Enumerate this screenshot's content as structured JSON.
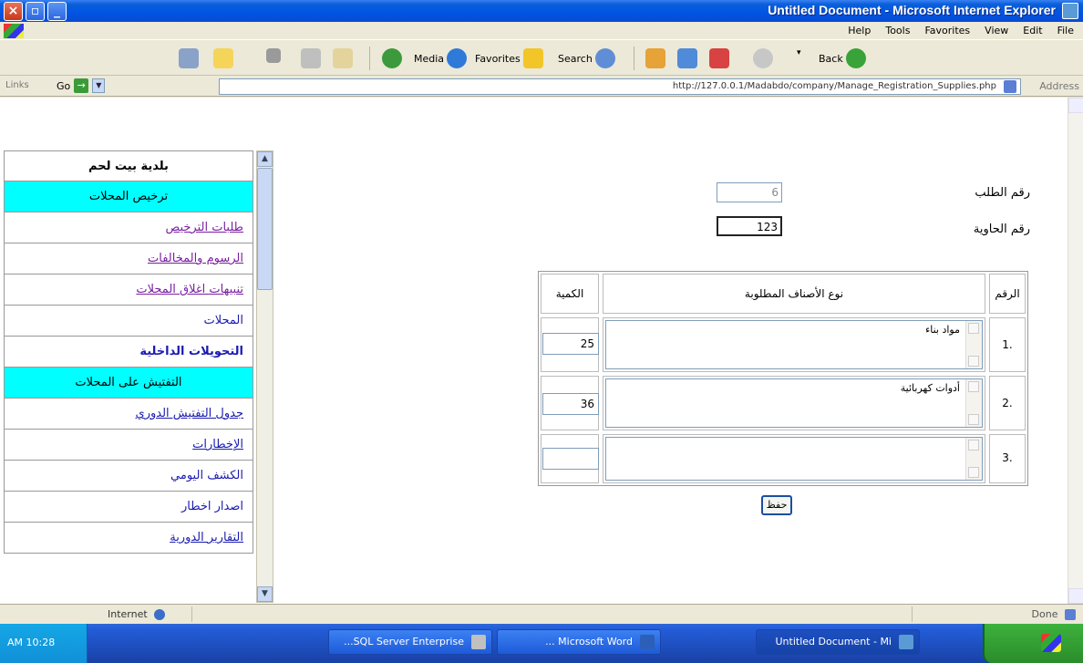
{
  "window": {
    "title": "Untitled Document - Microsoft Internet Explorer"
  },
  "menubar": {
    "items": [
      "File",
      "Edit",
      "View",
      "Favorites",
      "Tools",
      "Help"
    ]
  },
  "toolbar": {
    "back_label": "Back",
    "search_label": "Search",
    "favorites_label": "Favorites",
    "media_label": "Media"
  },
  "addressbar": {
    "links_label": "Links",
    "go_label": "Go",
    "url": "http://127.0.0.1/Madabdo/company/Manage_Registration_Supplies.php",
    "address_label": "Address"
  },
  "sidebar": {
    "items": [
      {
        "label": "بلدية بيت لحم"
      },
      {
        "label": "ترخيص المحلات"
      },
      {
        "label": "طلبات الترخيص"
      },
      {
        "label": "الرسوم والمخالفات"
      },
      {
        "label": "تنبيهات اغلاق المحلات"
      },
      {
        "label": "المحلات"
      },
      {
        "label": "التحويلات الداخلية"
      },
      {
        "label": "التفتيش على المحلات"
      },
      {
        "label": "جدول التفتيش الدوري"
      },
      {
        "label": "الإخطارات"
      },
      {
        "label": "الكشف اليومي"
      },
      {
        "label": "اصدار اخطار"
      },
      {
        "label": "التقارير الدورية"
      }
    ]
  },
  "form": {
    "field1_label": "رقم الطلب",
    "field1_value": "6",
    "field2_label": "رقم الحاوية",
    "field2_value": "123"
  },
  "table": {
    "headers": {
      "num": "الرقم",
      "type": "نوع الأصناف المطلوبة",
      "qty": "الكمية"
    },
    "rows": [
      {
        "num": "1.",
        "type": "مواد بناء",
        "qty": "25"
      },
      {
        "num": "2.",
        "type": "أدوات كهربائية",
        "qty": "36"
      },
      {
        "num": "3.",
        "type": "",
        "qty": ""
      }
    ],
    "submit_label": "حفظ"
  },
  "statusbar": {
    "left": "Internet",
    "right": "Done"
  },
  "taskbar": {
    "time": "AM 10:28",
    "tasks": [
      {
        "label": "...SQL Server Enterprise"
      },
      {
        "label": "... Microsoft Word"
      },
      {
        "label": "Untitled Document - Mi"
      }
    ]
  }
}
